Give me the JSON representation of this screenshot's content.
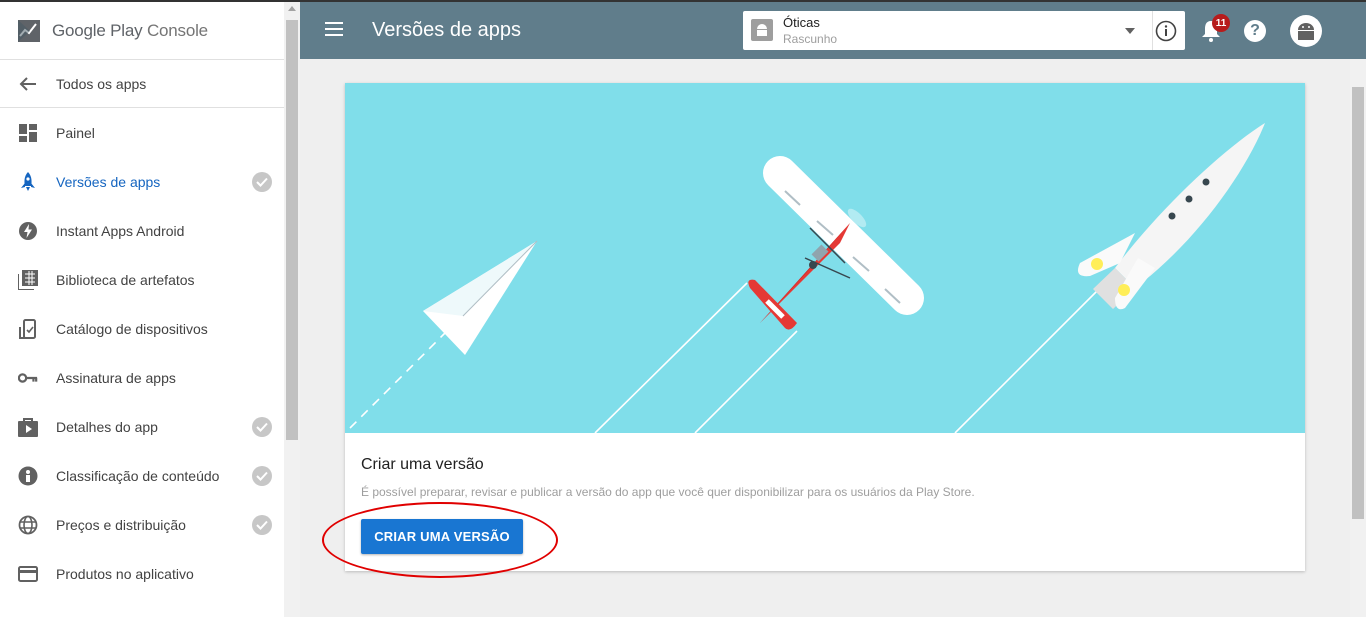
{
  "brand": {
    "name": "Google Play",
    "suffix": "Console"
  },
  "sidebar": {
    "back": {
      "label": "Todos os apps",
      "icon": "arrow-back-icon"
    },
    "items": [
      {
        "label": "Painel",
        "icon": "dashboard-icon",
        "checked": false,
        "active": false
      },
      {
        "label": "Versões de apps",
        "icon": "rocket-icon",
        "checked": true,
        "active": true
      },
      {
        "label": "Instant Apps Android",
        "icon": "bolt-icon",
        "checked": false,
        "active": false
      },
      {
        "label": "Biblioteca de artefatos",
        "icon": "library-icon",
        "checked": false,
        "active": false
      },
      {
        "label": "Catálogo de dispositivos",
        "icon": "devices-icon",
        "checked": false,
        "active": false
      },
      {
        "label": "Assinatura de apps",
        "icon": "key-icon",
        "checked": false,
        "active": false
      },
      {
        "label": "Detalhes do app",
        "icon": "store-icon",
        "checked": true,
        "active": false
      },
      {
        "label": "Classificação de conteúdo",
        "icon": "rating-icon",
        "checked": true,
        "active": false
      },
      {
        "label": "Preços e distribuição",
        "icon": "globe-icon",
        "checked": true,
        "active": false
      },
      {
        "label": "Produtos no aplicativo",
        "icon": "card-icon",
        "checked": false,
        "active": false
      }
    ]
  },
  "header": {
    "title": "Versões de apps",
    "app": {
      "name": "Óticas",
      "status": "Rascunho"
    },
    "notifications": "11"
  },
  "card": {
    "title": "Criar uma versão",
    "description": "É possível preparar, revisar e publicar a versão do app que você quer disponibilizar para os usuários da Play Store.",
    "button": "CRIAR UMA VERSÃO"
  },
  "colors": {
    "header": "#607d8b",
    "accent": "#1976d2",
    "illustration_bg": "#80deea",
    "annotation": "#e00000"
  }
}
